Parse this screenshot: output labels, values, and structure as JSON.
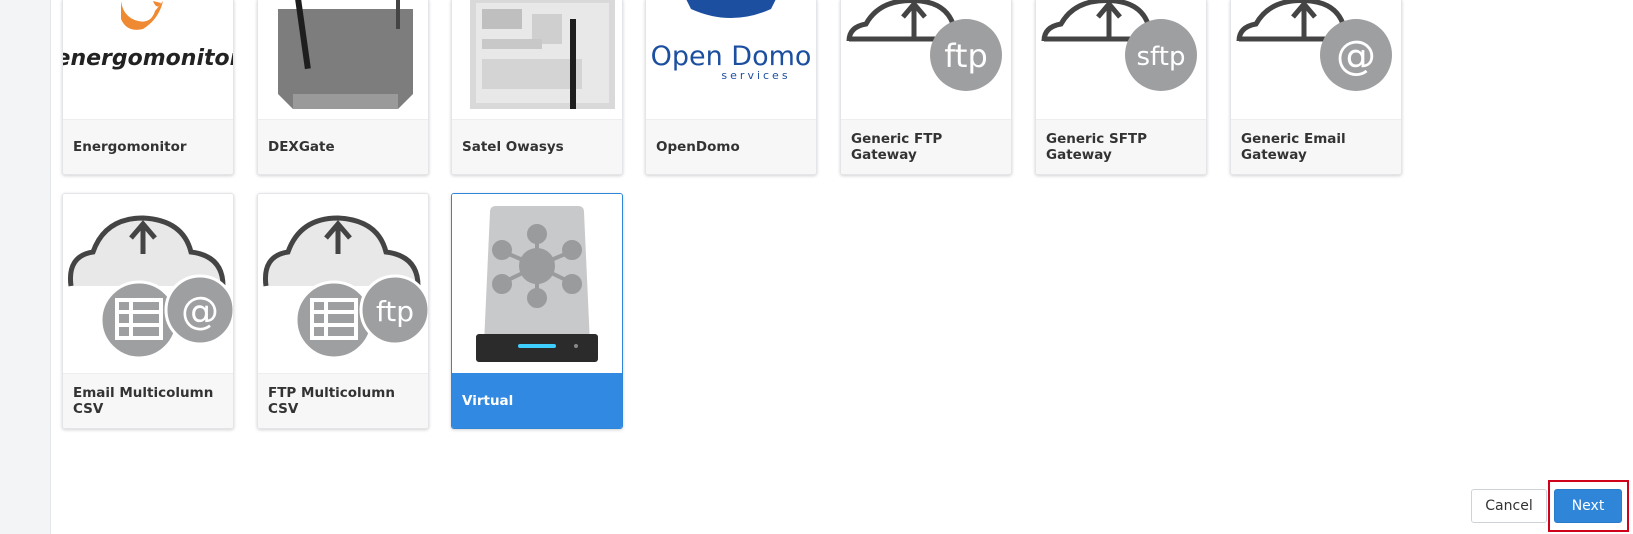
{
  "cards_row1": [
    {
      "label": "Energomonitor",
      "logo_text": "energomonitor"
    },
    {
      "label": "DEXGate"
    },
    {
      "label": "Satel Owasys"
    },
    {
      "label": "OpenDomo",
      "logo_text": "Open Domo",
      "logo_sub": "services"
    },
    {
      "label": "Generic FTP Gateway",
      "badge": "ftp"
    },
    {
      "label": "Generic SFTP Gateway",
      "badge": "sftp"
    },
    {
      "label": "Generic Email Gateway",
      "badge": "@"
    }
  ],
  "cards_row2": [
    {
      "label": "Email Multicolumn CSV",
      "badge": "@"
    },
    {
      "label": "FTP Multicolumn CSV",
      "badge": "ftp"
    },
    {
      "label": "Virtual",
      "selected": true
    }
  ],
  "buttons": {
    "cancel": "Cancel",
    "next": "Next"
  },
  "colors": {
    "accent": "#3189e2",
    "highlight": "#d0021b",
    "energomonitor_orange": "#f08a32",
    "opendomo_blue": "#1c4fa0"
  }
}
